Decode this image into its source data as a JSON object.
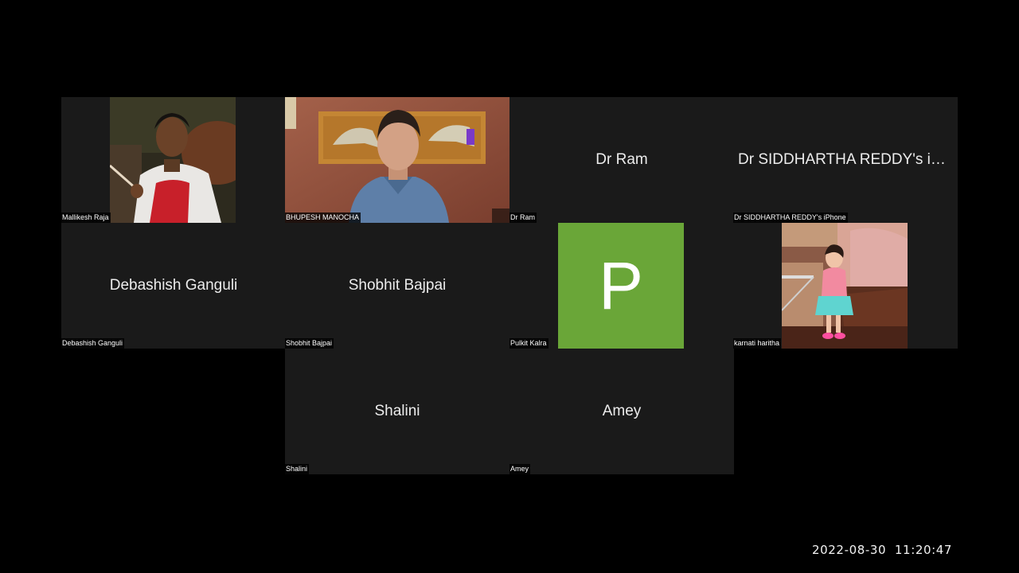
{
  "participants": [
    {
      "display_name": "Mallikesh Raja",
      "label": "Mallikesh Raja",
      "video": true
    },
    {
      "display_name": "BHUPESH MANOCHA",
      "label": "BHUPESH MANOCHA",
      "video": true
    },
    {
      "display_name": "Dr Ram",
      "label": "Dr Ram",
      "video": false
    },
    {
      "display_name": "Dr SIDDHARTHA REDDY's iPh...",
      "label": "Dr SIDDHARTHA REDDY's iPhone",
      "video": false
    },
    {
      "display_name": "Debashish Ganguli",
      "label": "Debashish Ganguli",
      "video": false
    },
    {
      "display_name": "Shobhit Bajpai",
      "label": "Shobhit Bajpai",
      "video": false
    },
    {
      "display_name": "Pulkit Kalra",
      "label": "Pulkit Kalra",
      "video": false,
      "avatar_initial": "P",
      "avatar_color": "#6aa638"
    },
    {
      "display_name": "karnati haritha",
      "label": "karnati haritha",
      "video": true
    },
    {
      "display_name": "Shalini",
      "label": "Shalini",
      "video": false
    },
    {
      "display_name": "Amey",
      "label": "Amey",
      "video": false
    }
  ],
  "timestamp": "2022-08-30  11:20:47",
  "colors": {
    "background": "#000000",
    "tile": "#1a1a1a",
    "name_text": "#ececec",
    "avatar_green": "#6aa638"
  }
}
